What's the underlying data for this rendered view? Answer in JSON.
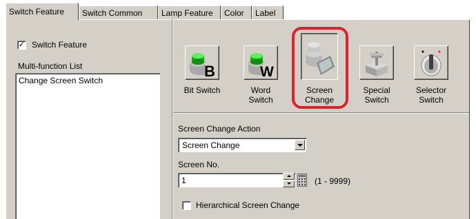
{
  "tabs": [
    {
      "label": "Switch Feature",
      "active": true
    },
    {
      "label": "Switch Common",
      "active": false
    },
    {
      "label": "Lamp Feature",
      "active": false
    },
    {
      "label": "Color",
      "active": false
    },
    {
      "label": "Label",
      "active": false
    }
  ],
  "left": {
    "switch_feature_checkbox": {
      "label": "Switch Feature",
      "checked": true,
      "mark": "✓"
    },
    "list_label": "Multi-function List",
    "list_items": [
      "Change Screen Switch"
    ]
  },
  "switch_types": [
    {
      "line1": "Bit Switch",
      "line2": "",
      "icon": "bit-switch-icon",
      "selected": false
    },
    {
      "line1": "Word",
      "line2": "Switch",
      "icon": "word-switch-icon",
      "selected": false
    },
    {
      "line1": "Screen",
      "line2": "Change",
      "icon": "screen-change-icon",
      "selected": true
    },
    {
      "line1": "Special",
      "line2": "Switch",
      "icon": "special-switch-icon",
      "selected": false
    },
    {
      "line1": "Selector",
      "line2": "Switch",
      "icon": "selector-switch-icon",
      "selected": false
    }
  ],
  "action": {
    "label": "Screen Change Action",
    "selected": "Screen Change"
  },
  "screen_no": {
    "label": "Screen No.",
    "value": "1",
    "range": "(1 - 9999)"
  },
  "hierarchical": {
    "label": "Hierarchical Screen Change",
    "checked": false
  },
  "colors": {
    "highlight": "#e0202c",
    "panel": "#d4d0c8",
    "green": "#22c022"
  }
}
